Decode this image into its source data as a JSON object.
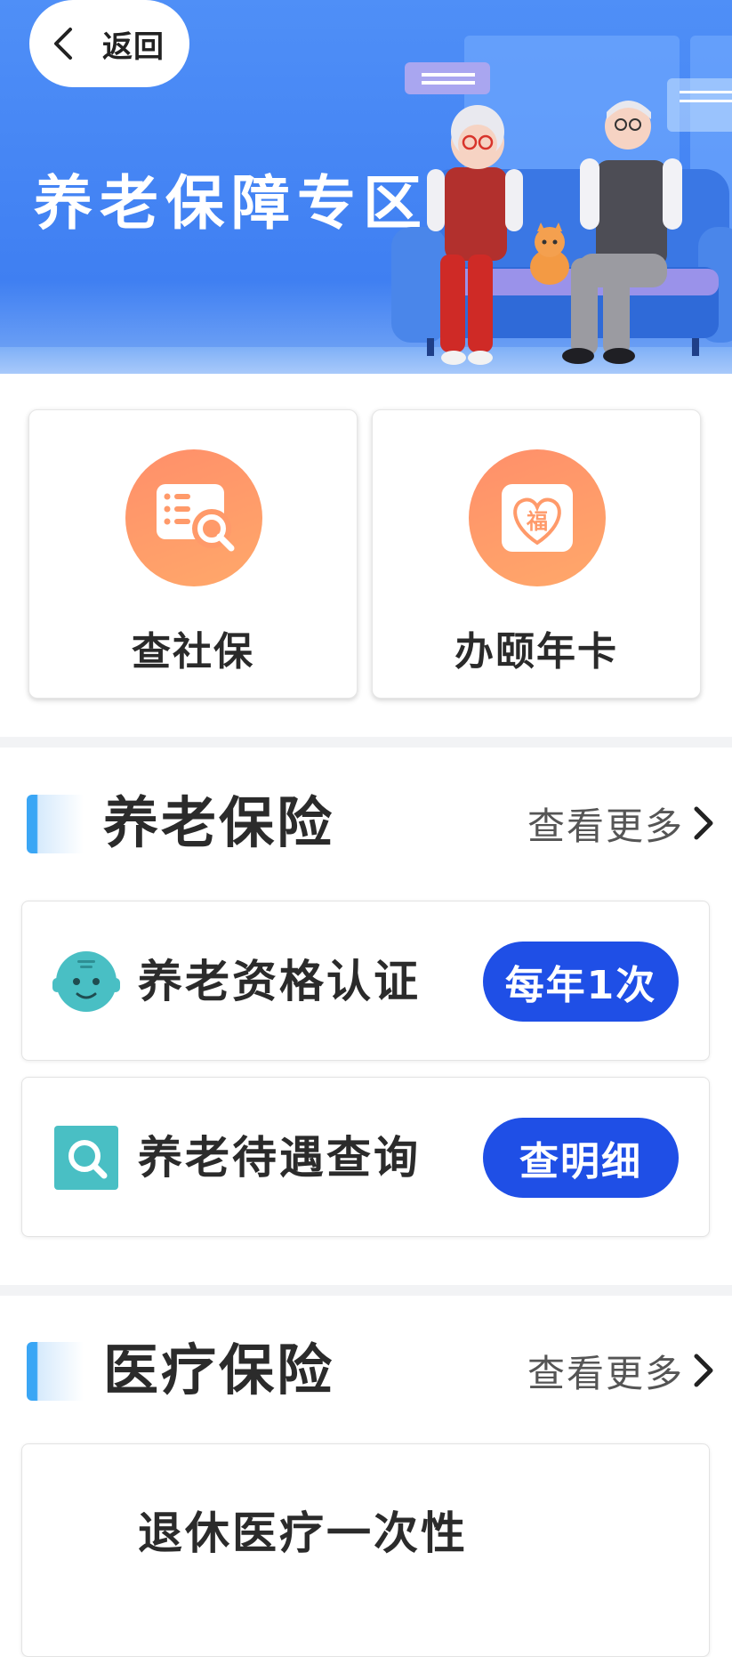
{
  "header": {
    "back_label": "返回",
    "banner_title": "养老保障专区"
  },
  "services": [
    {
      "label": "查社保",
      "icon": "social-security-search-icon"
    },
    {
      "label": "办颐年卡",
      "icon": "fortune-heart-card-icon",
      "icon_char": "福"
    }
  ],
  "sections": [
    {
      "title": "养老保险",
      "more_label": "查看更多",
      "items": [
        {
          "label": "养老资格认证",
          "action": "每年1次",
          "icon": "face-icon"
        },
        {
          "label": "养老待遇查询",
          "action": "查明细",
          "icon": "search-icon"
        }
      ]
    },
    {
      "title": "医疗保险",
      "more_label": "查看更多",
      "items": [
        {
          "label": "退休医疗一次性",
          "icon": ""
        }
      ]
    }
  ],
  "colors": {
    "banner_blue": "#4f8ff7",
    "accent_orange": "#ff9a6a",
    "pill_blue": "#1f4fe6",
    "section_bar_blue": "#3aa6f5",
    "face_teal": "#49bfc4"
  }
}
